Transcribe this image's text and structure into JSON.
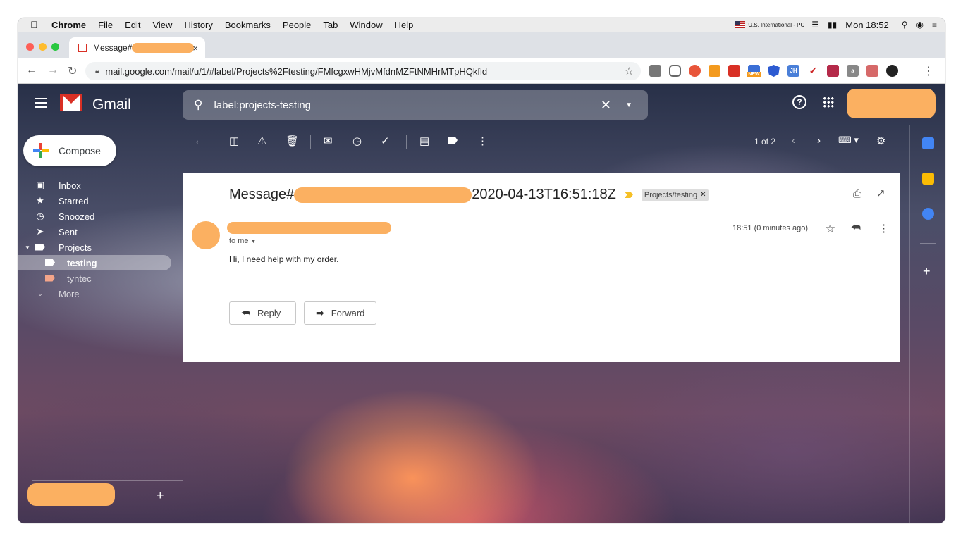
{
  "menubar": {
    "app": "Chrome",
    "items": [
      "File",
      "Edit",
      "View",
      "History",
      "Bookmarks",
      "People",
      "Tab",
      "Window",
      "Help"
    ],
    "keyboard": "U.S. International - PC",
    "clock": "Mon 18:52"
  },
  "tab": {
    "title": "Message#",
    "close": "×"
  },
  "address": {
    "url": "mail.google.com/mail/u/1/#label/Projects%2Ftesting/FMfcgxwHMjvMfdnMZFtNMHrMTpHQkfld"
  },
  "extensions": {
    "new_badge": "NEW",
    "jh_label": "JH",
    "a_label": "a"
  },
  "gmail": {
    "product": "Gmail",
    "search_value": "label:projects-testing",
    "compose_label": "Compose",
    "nav": {
      "inbox": "Inbox",
      "starred": "Starred",
      "snoozed": "Snoozed",
      "sent": "Sent",
      "projects": "Projects",
      "testing": "testing",
      "tyntec": "tyntec",
      "more": "More"
    },
    "pager": "1 of 2",
    "message": {
      "subject_prefix": "Message#",
      "subject_suffix": "2020-04-13T16:51:18Z",
      "label_chip": "Projects/testing",
      "to": "to me",
      "time": "18:51 (0 minutes ago)",
      "body": "Hi, I need help with my order.",
      "reply": "Reply",
      "forward": "Forward"
    }
  },
  "colors": {
    "redaction": "#fbb061",
    "gmail_red": "#d93025",
    "important": "#f6c026",
    "label_testing": "#ffffff",
    "label_tyntec": "#f4a58a"
  }
}
